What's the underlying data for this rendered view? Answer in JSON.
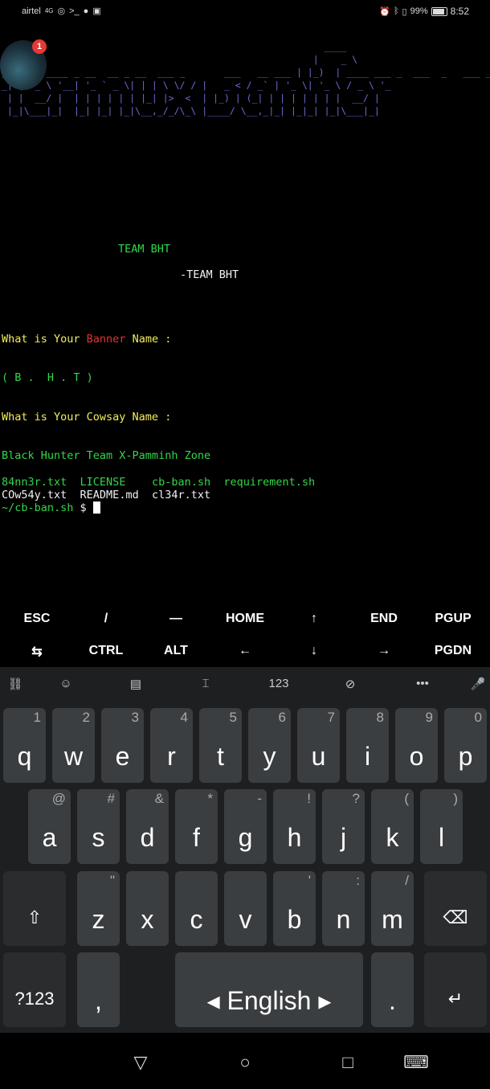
{
  "status": {
    "carrier": "airtel",
    "signal": "4G",
    "battery": "99%",
    "time": "8:52",
    "notification_count": "1"
  },
  "terminal": {
    "banner_ascii": "                                                          ____\n _                                                      |    _ \\\n_ | |   ____ _ __  __ _ __  ___ _       ___   __ ___ | |_)  | ____ ___ _  ___  _   ___ _ _\n_| |/ _ \\ '__| '_ ` _ \\| | | \\ \\/ / |   _ < / _` | '_ \\| '_ \\ / _ \\ '_\n | |  __/ |  | | | | | | |_| |>  <  | |_) | (_| | | | | | | |  __/ |\n |_|\\___|_|  |_| |_| |_|\\__,_/_/\\_\\ |____/ \\__,_|_| |_|_| |_|\\___|_|",
    "team_line_1": "TEAM BHT",
    "team_line_2": "-TEAM BHT",
    "banner_prompt_a": "What is Your ",
    "banner_prompt_b": "Banner",
    "banner_prompt_c": " Name :",
    "banner_value": "( B .  H . T )",
    "cowsay_prompt": "What is Your Cowsay Name :",
    "cowsay_value": "Black Hunter Team X-Pamminh Zone",
    "files": [
      [
        "84nn3r.txt",
        "LICENSE",
        "cb-ban.sh",
        "requirement.sh"
      ],
      [
        "COw54y.txt",
        "README.md",
        "cl34r.txt",
        ""
      ]
    ],
    "prompt_path": "~/cb-ban.sh",
    "prompt_symbol": "$"
  },
  "extra_keys": {
    "row1": [
      "ESC",
      "/",
      "—",
      "HOME",
      "↑",
      "END",
      "PGUP"
    ],
    "row2": [
      "⇆",
      "CTRL",
      "ALT",
      "←",
      "↓",
      "→",
      "PGDN"
    ]
  },
  "keyboard": {
    "toolbar": [
      "translate-icon",
      "emoji-icon",
      "clipboard-icon",
      "text-cursor-icon",
      "123",
      "no-incognito-icon",
      "more-icon",
      "mic-icon"
    ],
    "toolbar_123": "123",
    "toolbar_more": "•••",
    "row1": [
      [
        "q",
        "1"
      ],
      [
        "w",
        "2"
      ],
      [
        "e",
        "3"
      ],
      [
        "r",
        "4"
      ],
      [
        "t",
        "5"
      ],
      [
        "y",
        "6"
      ],
      [
        "u",
        "7"
      ],
      [
        "i",
        "8"
      ],
      [
        "o",
        "9"
      ],
      [
        "p",
        "0"
      ]
    ],
    "row2": [
      [
        "a",
        "@"
      ],
      [
        "s",
        "#"
      ],
      [
        "d",
        "&"
      ],
      [
        "f",
        "*"
      ],
      [
        "g",
        "-"
      ],
      [
        "h",
        "!"
      ],
      [
        "j",
        "?"
      ],
      [
        "k",
        "("
      ],
      [
        "l",
        ")"
      ]
    ],
    "row3": [
      [
        "z",
        "\""
      ],
      [
        "x",
        ""
      ],
      [
        "c",
        ""
      ],
      [
        "v",
        ""
      ],
      [
        "b",
        "'"
      ],
      [
        "n",
        ":"
      ],
      [
        "m",
        "/"
      ]
    ],
    "symbols_label": "?123",
    "comma": ",",
    "space_label": "English",
    "period": ".",
    "shift": "⇧",
    "backspace": "⌫",
    "enter": "↵"
  }
}
